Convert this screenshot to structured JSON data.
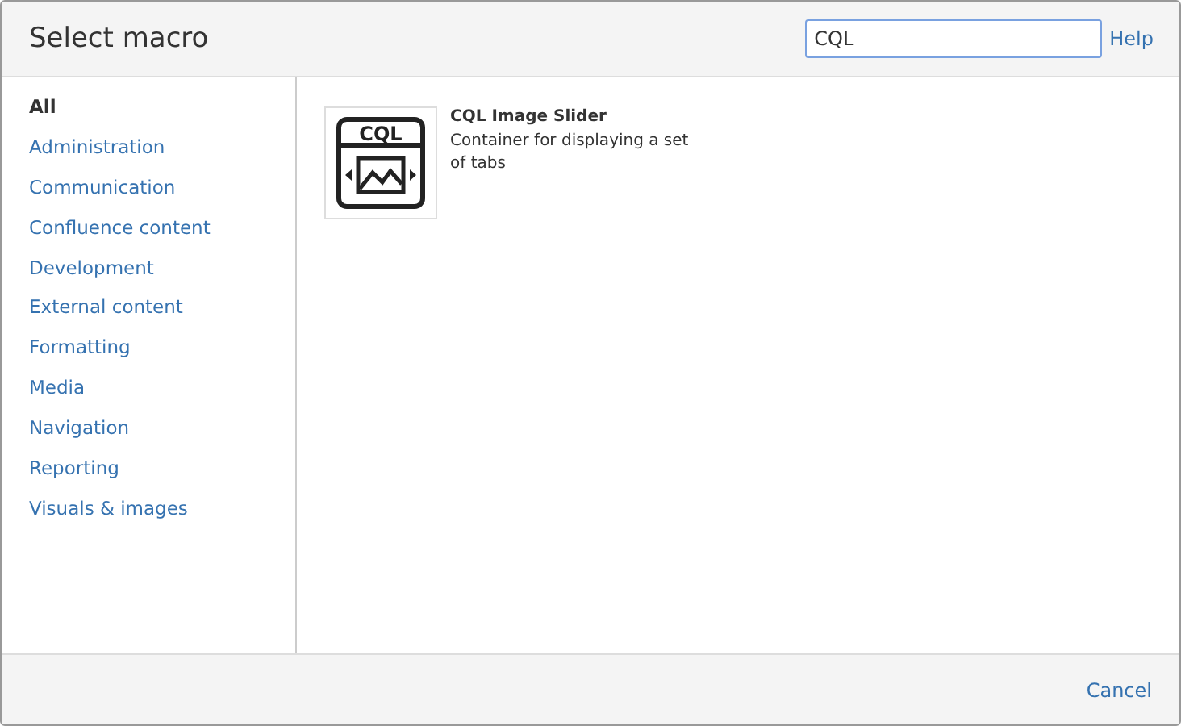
{
  "dialog": {
    "title": "Select macro",
    "search": {
      "value": "CQL"
    },
    "help": "Help"
  },
  "categories": [
    {
      "label": "All",
      "selected": true
    },
    {
      "label": "Administration",
      "selected": false
    },
    {
      "label": "Communication",
      "selected": false
    },
    {
      "label": "Confluence content",
      "selected": false
    },
    {
      "label": "Development",
      "selected": false
    },
    {
      "label": "External content",
      "selected": false
    },
    {
      "label": "Formatting",
      "selected": false
    },
    {
      "label": "Media",
      "selected": false
    },
    {
      "label": "Navigation",
      "selected": false
    },
    {
      "label": "Reporting",
      "selected": false
    },
    {
      "label": "Visuals & images",
      "selected": false
    }
  ],
  "macros": [
    {
      "name": "CQL Image Slider",
      "description": "Container for displaying a set of tabs",
      "icon_label": "CQL"
    }
  ],
  "footer": {
    "cancel": "Cancel"
  }
}
